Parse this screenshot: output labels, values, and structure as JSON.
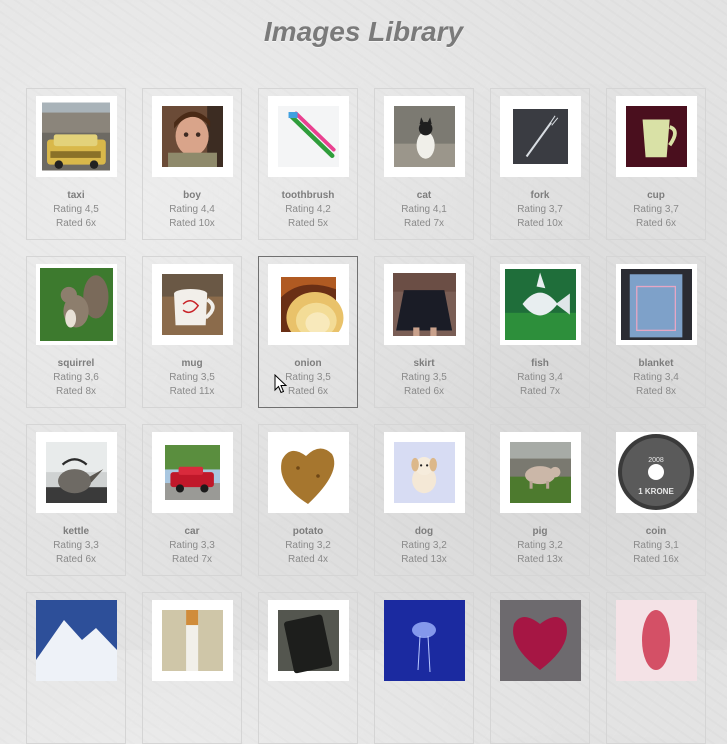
{
  "page": {
    "title": "Images Library"
  },
  "images": [
    {
      "name": "taxi",
      "rating": "Rating 4,5",
      "rated": "Rated 6x",
      "icon": "taxi-photo"
    },
    {
      "name": "boy",
      "rating": "Rating 4,4",
      "rated": "Rated 10x",
      "icon": "boy-photo"
    },
    {
      "name": "toothbrush",
      "rating": "Rating 4,2",
      "rated": "Rated 5x",
      "icon": "toothbrush-photo"
    },
    {
      "name": "cat",
      "rating": "Rating 4,1",
      "rated": "Rated 7x",
      "icon": "cat-photo"
    },
    {
      "name": "fork",
      "rating": "Rating 3,7",
      "rated": "Rated 10x",
      "icon": "fork-photo"
    },
    {
      "name": "cup",
      "rating": "Rating 3,7",
      "rated": "Rated 6x",
      "icon": "cup-photo"
    },
    {
      "name": "squirrel",
      "rating": "Rating 3,6",
      "rated": "Rated 8x",
      "icon": "squirrel-photo"
    },
    {
      "name": "mug",
      "rating": "Rating 3,5",
      "rated": "Rated 11x",
      "icon": "mug-photo"
    },
    {
      "name": "onion",
      "rating": "Rating 3,5",
      "rated": "Rated 6x",
      "icon": "onion-photo"
    },
    {
      "name": "skirt",
      "rating": "Rating 3,5",
      "rated": "Rated 6x",
      "icon": "skirt-photo"
    },
    {
      "name": "fish",
      "rating": "Rating 3,4",
      "rated": "Rated 7x",
      "icon": "fish-photo"
    },
    {
      "name": "blanket",
      "rating": "Rating 3,4",
      "rated": "Rated 8x",
      "icon": "blanket-photo"
    },
    {
      "name": "kettle",
      "rating": "Rating 3,3",
      "rated": "Rated 6x",
      "icon": "kettle-photo"
    },
    {
      "name": "car",
      "rating": "Rating 3,3",
      "rated": "Rated 7x",
      "icon": "car-photo"
    },
    {
      "name": "potato",
      "rating": "Rating 3,2",
      "rated": "Rated 4x",
      "icon": "potato-photo"
    },
    {
      "name": "dog",
      "rating": "Rating 3,2",
      "rated": "Rated 13x",
      "icon": "dog-photo"
    },
    {
      "name": "pig",
      "rating": "Rating 3,2",
      "rated": "Rated 13x",
      "icon": "pig-photo"
    },
    {
      "name": "coin",
      "rating": "Rating 3,1",
      "rated": "Rated 16x",
      "icon": "coin-photo",
      "coin_text": "2008 1 KRONE"
    },
    {
      "name": "",
      "rating": "",
      "rated": "",
      "icon": "mountain-photo"
    },
    {
      "name": "",
      "rating": "",
      "rated": "",
      "icon": "cigarette-photo"
    },
    {
      "name": "",
      "rating": "",
      "rated": "",
      "icon": "phone-photo"
    },
    {
      "name": "",
      "rating": "",
      "rated": "",
      "icon": "jellyfish-photo"
    },
    {
      "name": "",
      "rating": "",
      "rated": "",
      "icon": "heart-photo"
    },
    {
      "name": "",
      "rating": "",
      "rated": "",
      "icon": "blurred-red-photo"
    }
  ],
  "hovered_item": "onion"
}
